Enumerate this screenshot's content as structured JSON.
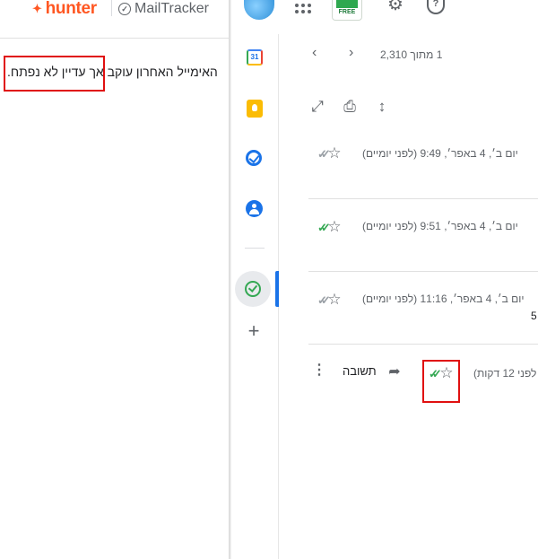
{
  "extension": {
    "hunter_label": "hunter",
    "mailtracker_label": "MailTracker",
    "tooltip_text": "האימייל האחרון עוקב אך עדיין לא נפתח."
  },
  "topbar": {
    "free_badge": "FREE"
  },
  "toolbar": {
    "pager_text": "1 מתוך 2,310"
  },
  "thread": {
    "messages": [
      {
        "date": "יום ב׳, 4 באפר׳, 9:49 (לפני יומיים)",
        "tracking_status": "sent-not-opened"
      },
      {
        "date": "יום ב׳, 4 באפר׳, 9:51 (לפני יומיים)",
        "tracking_status": "opened"
      },
      {
        "date": "יום ב׳, 4 באפר׳, 11:16 (לפני יומיים)",
        "tracking_status": "sent-not-opened",
        "extra_text": "5"
      },
      {
        "date": "לפני 12 דקות)",
        "tracking_status": "opened",
        "reply_label": "תשובה"
      }
    ]
  },
  "icons": [
    "chevron-left-icon",
    "chevron-right-icon",
    "open-new-window-icon",
    "print-icon",
    "expand-collapse-icon",
    "star-icon",
    "double-check-icon",
    "reply-arrow-icon",
    "more-vert-icon",
    "gear-icon",
    "help-icon",
    "apps-grid-icon",
    "add-icon"
  ],
  "colors": {
    "hunter_brand": "#ff5722",
    "tracked_opened": "#34a853",
    "tracked_unopened": "#9aa0a6",
    "highlight": "#e01010",
    "active_app": "#1a73e8"
  }
}
